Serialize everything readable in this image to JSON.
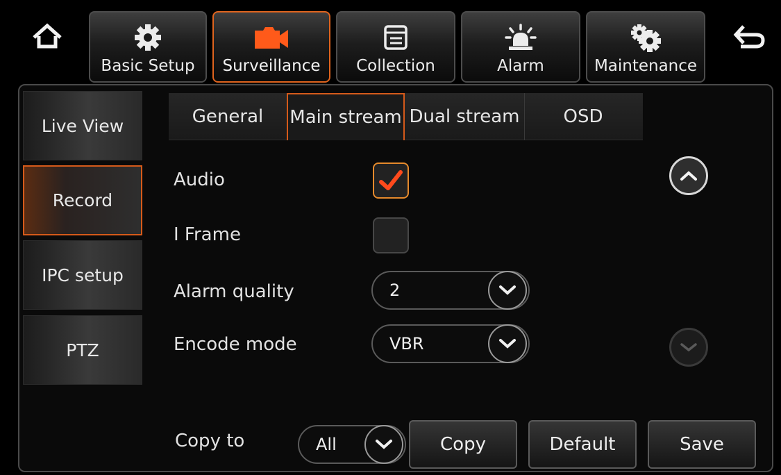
{
  "nav": {
    "tabs": [
      {
        "label": "Basic Setup",
        "icon": "gear-icon"
      },
      {
        "label": "Surveillance",
        "icon": "camera-icon"
      },
      {
        "label": "Collection",
        "icon": "document-icon"
      },
      {
        "label": "Alarm",
        "icon": "siren-icon"
      },
      {
        "label": "Maintenance",
        "icon": "gears-icon"
      }
    ],
    "active": "Surveillance"
  },
  "sidebar": {
    "items": [
      {
        "label": "Live View"
      },
      {
        "label": "Record"
      },
      {
        "label": "IPC setup"
      },
      {
        "label": "PTZ"
      }
    ],
    "active": "Record"
  },
  "subtabs": {
    "items": [
      {
        "label": "General"
      },
      {
        "label": "Main stream"
      },
      {
        "label": "Dual stream"
      },
      {
        "label": "OSD"
      }
    ],
    "active": "Main stream"
  },
  "form": {
    "audio": {
      "label": "Audio",
      "checked": true
    },
    "iframe": {
      "label": "I Frame",
      "checked": false
    },
    "alarm_quality": {
      "label": "Alarm quality",
      "value": "2"
    },
    "encode_mode": {
      "label": "Encode mode",
      "value": "VBR"
    }
  },
  "footer": {
    "copy_to_label": "Copy to",
    "copy_to_value": "All",
    "copy_button": "Copy",
    "default_button": "Default",
    "save_button": "Save"
  },
  "colors": {
    "accent": "#e0641e",
    "check": "#ff4a1c",
    "background": "#000000"
  }
}
